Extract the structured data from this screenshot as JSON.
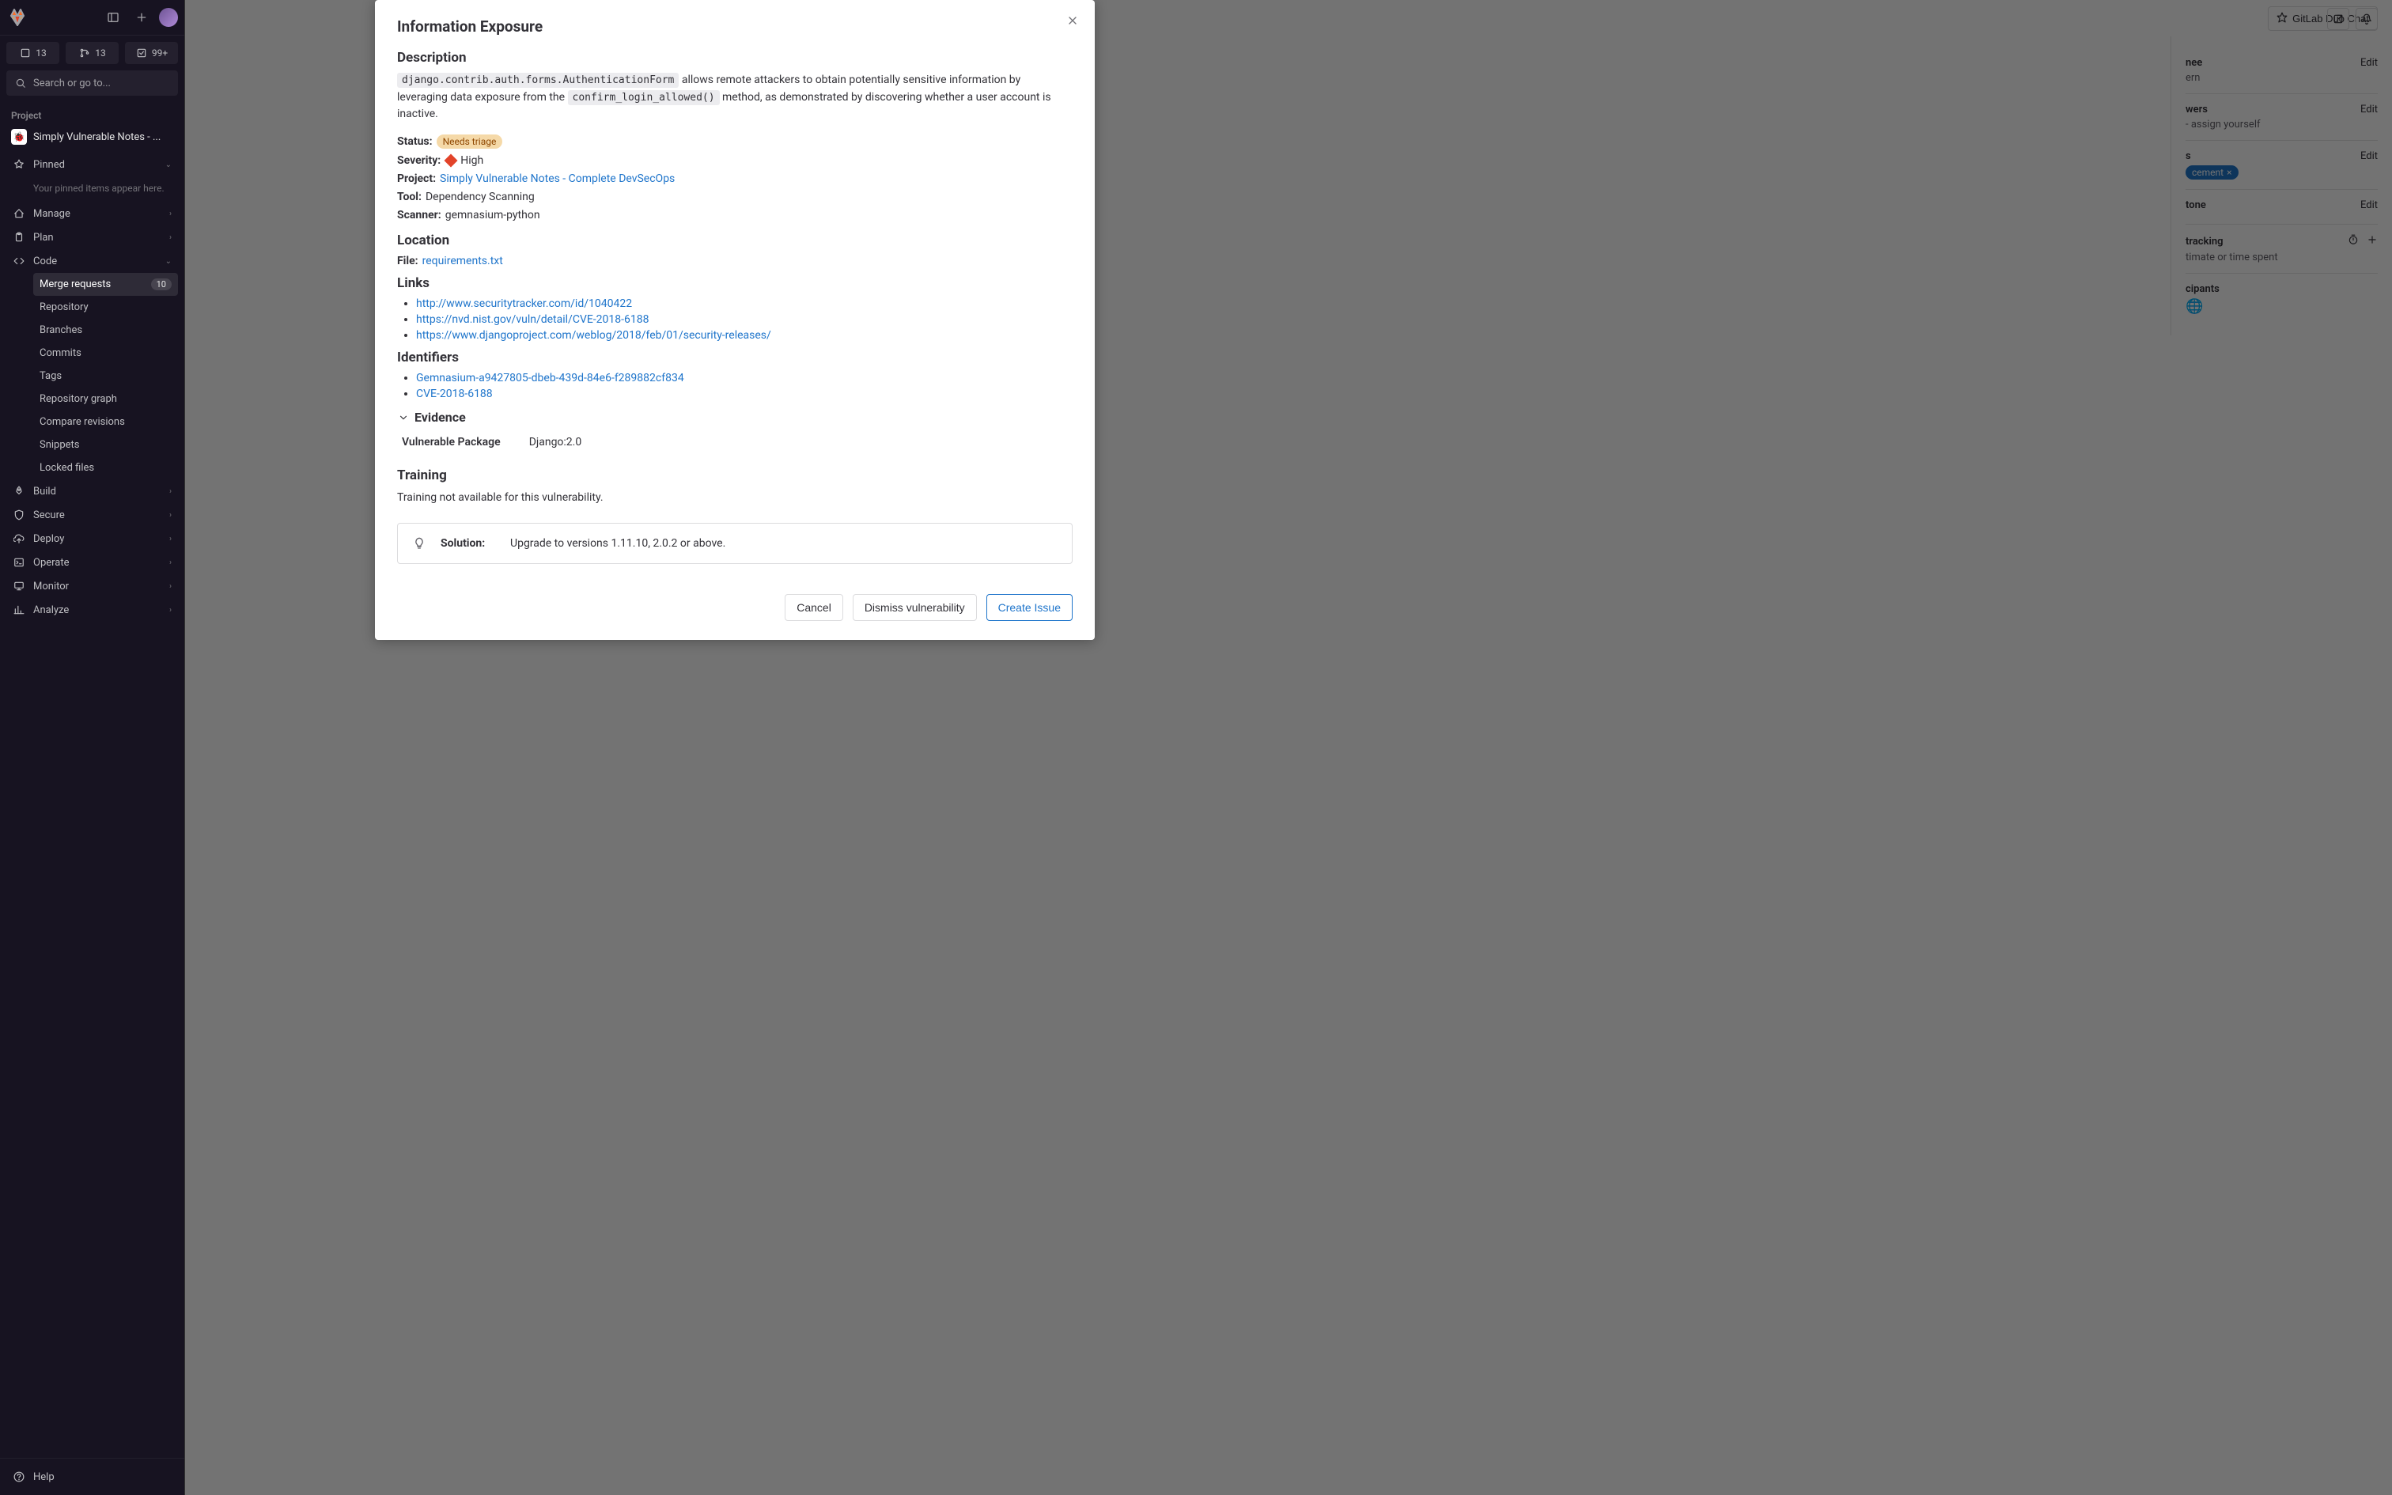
{
  "header": {
    "duo_chat": "GitLab Duo Chat"
  },
  "sidebar": {
    "counters": [
      {
        "label": "13"
      },
      {
        "label": "13"
      },
      {
        "label": "99+"
      }
    ],
    "search_placeholder": "Search or go to...",
    "project_label": "Project",
    "project_name": "Simply Vulnerable Notes - ...",
    "project_avatar": "🐞",
    "pinned": "Pinned",
    "pinned_hint": "Your pinned items appear here.",
    "nav": {
      "manage": "Manage",
      "plan": "Plan",
      "code": "Code",
      "merge_requests": "Merge requests",
      "merge_requests_count": "10",
      "repository": "Repository",
      "branches": "Branches",
      "commits": "Commits",
      "tags": "Tags",
      "repository_graph": "Repository graph",
      "compare_revisions": "Compare revisions",
      "snippets": "Snippets",
      "locked_files": "Locked files",
      "build": "Build",
      "secure": "Secure",
      "deploy": "Deploy",
      "operate": "Operate",
      "monitor": "Monitor",
      "analyze": "Analyze"
    },
    "help": "Help"
  },
  "right_panel": {
    "assignee": {
      "title": "nee",
      "value": "ern",
      "edit": "Edit"
    },
    "reviewers": {
      "title": "wers",
      "value": "- assign yourself",
      "edit": "Edit"
    },
    "labels": {
      "title": "s",
      "pill": "cement",
      "edit": "Edit"
    },
    "milestone": {
      "title": "tone",
      "edit": "Edit"
    },
    "time_tracking": {
      "title": "tracking",
      "value": "timate or time spent"
    },
    "participants": {
      "title": "cipants",
      "avatar": "🌐"
    }
  },
  "modal": {
    "title": "Information Exposure",
    "sections": {
      "description": "Description",
      "location": "Location",
      "links": "Links",
      "identifiers": "Identifiers",
      "evidence": "Evidence",
      "training": "Training"
    },
    "description": {
      "code1": "django.contrib.auth.forms.AuthenticationForm",
      "text1": " allows remote attackers to obtain potentially sensitive information by leveraging data exposure from the ",
      "code2": "confirm_login_allowed()",
      "text2": " method, as demonstrated by discovering whether a user account is inactive."
    },
    "meta": {
      "status_label": "Status:",
      "status_value": "Needs triage",
      "severity_label": "Severity:",
      "severity_value": "High",
      "project_label": "Project:",
      "project_value": "Simply Vulnerable Notes - Complete DevSecOps",
      "tool_label": "Tool:",
      "tool_value": "Dependency Scanning",
      "scanner_label": "Scanner:",
      "scanner_value": "gemnasium-python"
    },
    "location": {
      "file_label": "File:",
      "file_value": "requirements.txt"
    },
    "links": [
      "http://www.securitytracker.com/id/1040422",
      "https://nvd.nist.gov/vuln/detail/CVE-2018-6188",
      "https://www.djangoproject.com/weblog/2018/feb/01/security-releases/"
    ],
    "identifiers": [
      "Gemnasium-a9427805-dbeb-439d-84e6-f289882cf834",
      "CVE-2018-6188"
    ],
    "evidence": {
      "package_label": "Vulnerable Package",
      "package_value": "Django:2.0"
    },
    "training_text": "Training not available for this vulnerability.",
    "solution": {
      "label": "Solution:",
      "value": "Upgrade to versions 1.11.10, 2.0.2 or above."
    },
    "buttons": {
      "cancel": "Cancel",
      "dismiss": "Dismiss vulnerability",
      "create": "Create Issue"
    }
  }
}
